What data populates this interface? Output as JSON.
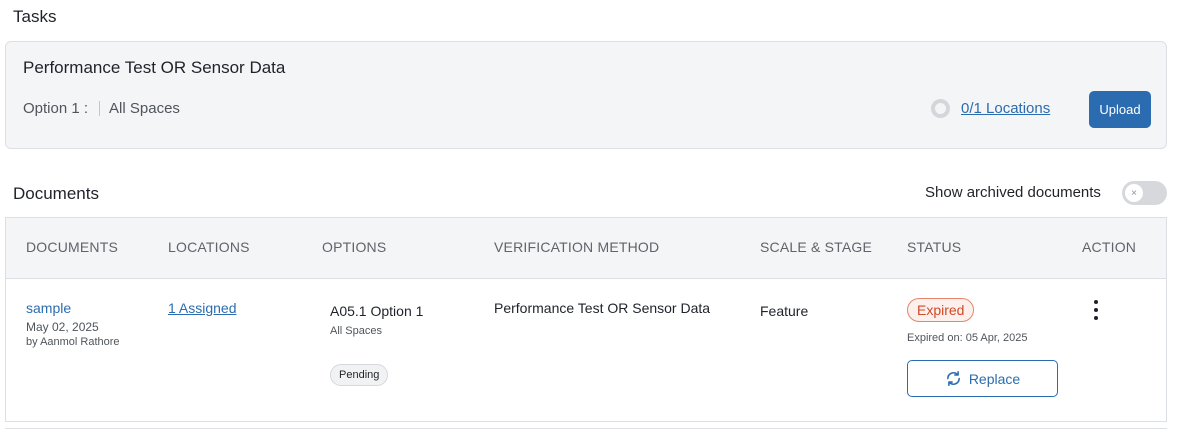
{
  "tasks": {
    "title": "Tasks",
    "card": {
      "name": "Performance Test OR Sensor Data",
      "option_label": "Option 1 :",
      "option_value": "All Spaces",
      "locations_link": "0/1 Locations",
      "upload_label": "Upload"
    }
  },
  "documents": {
    "title": "Documents",
    "archived_label": "Show archived documents",
    "archived_toggle_glyph": "×",
    "archived_toggle_on": false,
    "columns": [
      "DOCUMENTS",
      "LOCATIONS",
      "OPTIONS",
      "VERIFICATION METHOD",
      "SCALE & STAGE",
      "STATUS",
      "ACTION"
    ],
    "rows": [
      {
        "doc_name": "sample",
        "doc_date": "May 02, 2025",
        "doc_author": "by Aanmol Rathore",
        "locations": "1 Assigned",
        "option_name": "A05.1 Option 1",
        "option_scope": "All Spaces",
        "option_status": "Pending",
        "verification_method": "Performance Test OR Sensor Data",
        "scale_stage": "Feature",
        "status": "Expired",
        "expired_on": "Expired on: 05 Apr, 2025",
        "replace_label": "Replace"
      }
    ]
  },
  "colors": {
    "accent": "#2b6cb0",
    "expired": "#cf4a26",
    "panel_bg": "#f4f5f7"
  }
}
